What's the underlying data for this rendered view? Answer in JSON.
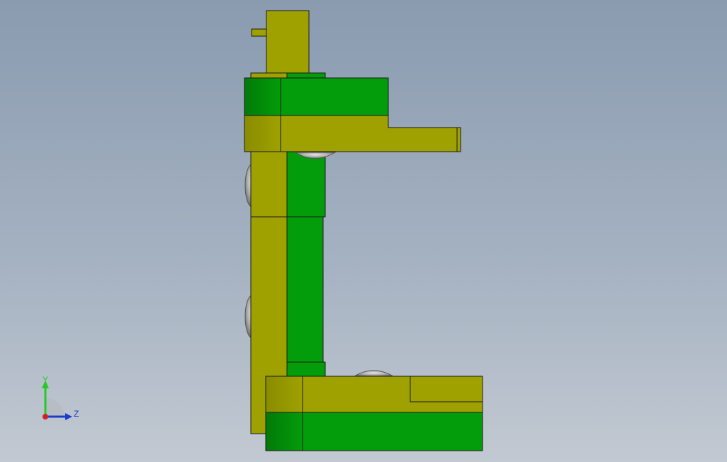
{
  "colors": {
    "background_top": "#8a9bb0",
    "background_bottom": "#c2c9d2",
    "part_olive": "#9fa100",
    "part_olive_dark": "#8a8c00",
    "part_green": "#039c0a",
    "part_green_dark": "#027a08",
    "screw_grey": "#9a9a9a",
    "edge": "#1a1a1a",
    "axis_y": "#22cc22",
    "axis_z": "#1a3dcc",
    "axis_x_origin": "#d42020"
  },
  "triad": {
    "y_label": "Y",
    "z_label": "Z"
  },
  "icons": {
    "triad": "coordinate-triad-icon"
  }
}
